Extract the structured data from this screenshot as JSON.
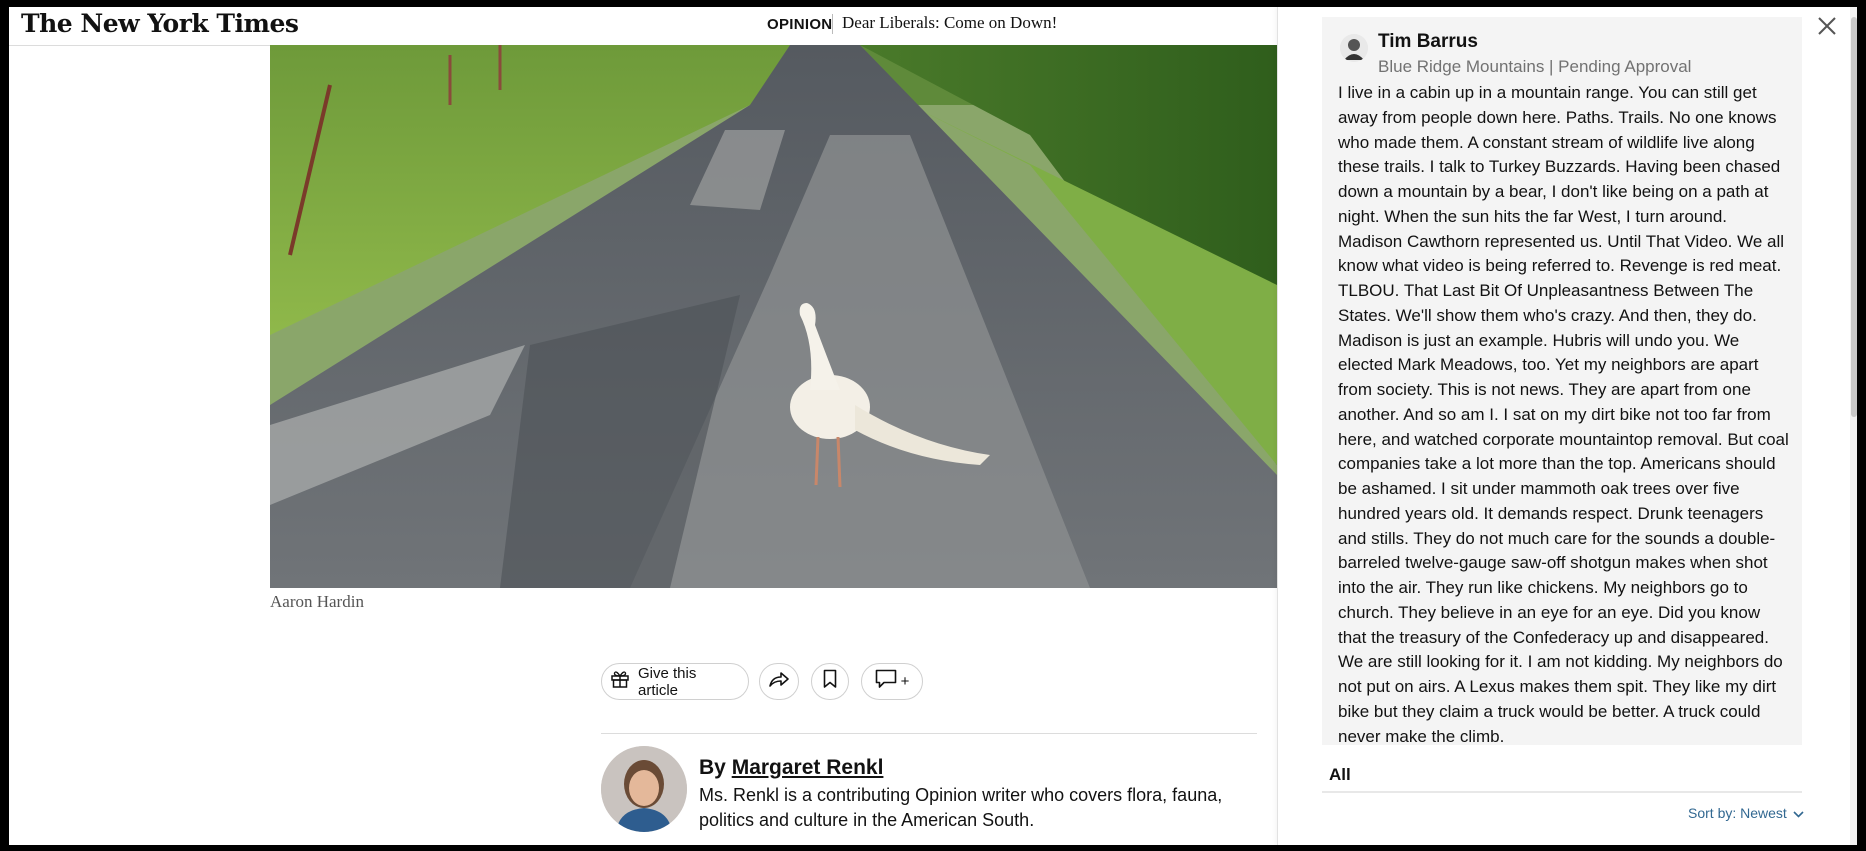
{
  "header": {
    "logo": "The New York Times",
    "section": "OPINION",
    "headline": "Dear Liberals: Come on Down!"
  },
  "article": {
    "image_caption": "Aaron Hardin",
    "toolbar": {
      "gift_label": "Give this article",
      "comments_plus": "+"
    },
    "byline": {
      "prefix": "By",
      "author": "Margaret Renkl",
      "bio": "Ms. Renkl is a contributing Opinion writer who covers flora, fauna, politics and culture in the American South."
    }
  },
  "comments": {
    "comment": {
      "author": "Tim Barrus",
      "location": "Blue Ridge Mountains | Pending Approval",
      "text": "I live in a cabin up in a mountain range. You can still get away from people down here. Paths. Trails. No one knows who made them. A constant stream of wildlife live along these trails. I talk to Turkey Buzzards. Having been chased down a mountain by a bear, I don't like being on a path at night. When the sun hits the far West, I turn around. Madison Cawthorn represented us. Until That Video. We all know what video is being referred to. Revenge is red meat. TLBOU. That Last Bit Of Unpleasantness Between The States. We'll show them who's crazy. And then, they do. Madison is just an example. Hubris will undo you. We elected Mark Meadows, too. Yet my neighbors are apart from society. This is not news. They are apart from one another. And so am I. I sat on my dirt bike not too far from here, and watched corporate mountaintop removal. But coal companies take a lot more than the top. Americans should be ashamed. I sit under mammoth oak trees over five hundred years old. It demands respect. Drunk teenagers and stills. They do not much care for the sounds a double-barreled twelve-gauge saw-off shotgun makes when shot into the air. They run like chickens. My neighbors go to church. They believe in an eye for an eye. Did you know that the treasury of the Confederacy up and disappeared. We are still looking for it. I am not kidding. My neighbors do not put on airs. A Lexus makes them spit. They like my dirt bike but they claim a truck would be better. A truck could never make the climb."
    },
    "tab_all": "All",
    "sort_label": "Sort by: Newest"
  },
  "colors": {
    "link_blue": "#326891",
    "card_bg": "#f4f4f4",
    "meta_gray": "#727272"
  }
}
